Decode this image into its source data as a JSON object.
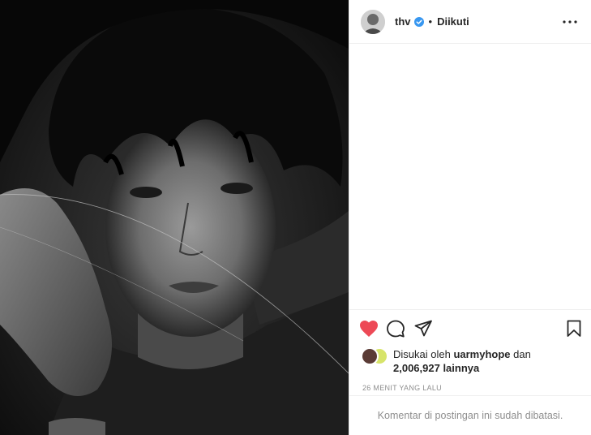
{
  "header": {
    "username": "thv",
    "separator": "•",
    "follow_status": "Diikuti"
  },
  "likes": {
    "prefix": "Disukai oleh",
    "liked_by": "uarmyhope",
    "connector": "dan",
    "count": "2,006,927 lainnya"
  },
  "timestamp": "26 MENIT YANG LALU",
  "footer": {
    "comments_disabled": "Komentar di postingan ini sudah dibatasi."
  },
  "icons": {
    "like": "heart-filled-icon",
    "comment": "comment-icon",
    "share": "paper-plane-icon",
    "save": "bookmark-icon",
    "more": "more-horizontal-icon",
    "verified": "verified-badge-icon"
  },
  "colors": {
    "like_red": "#ed4956",
    "verified_blue": "#3897f0",
    "muted_text": "#8e8e8e",
    "divider": "#efefef"
  }
}
